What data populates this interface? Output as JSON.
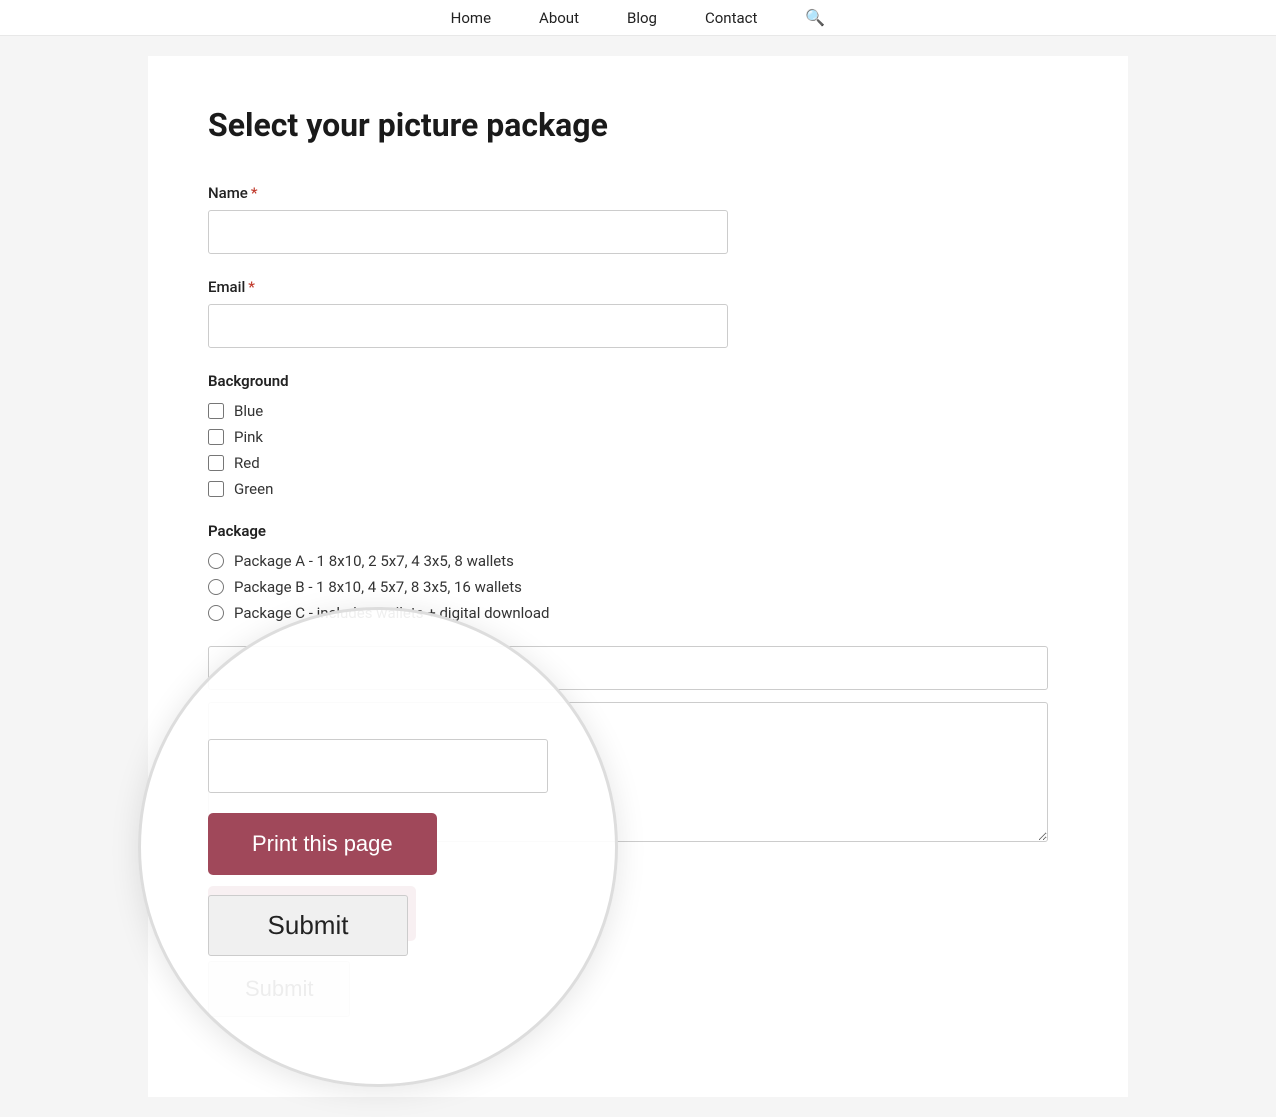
{
  "nav": {
    "items": [
      {
        "label": "Home",
        "id": "home"
      },
      {
        "label": "About",
        "id": "about"
      },
      {
        "label": "Blog",
        "id": "blog"
      },
      {
        "label": "Contact",
        "id": "contact"
      }
    ],
    "search_icon": "🔍"
  },
  "page": {
    "title": "Select your picture package"
  },
  "form": {
    "name_label": "Name",
    "email_label": "Email",
    "background_label": "Background",
    "background_options": [
      {
        "label": "Blue",
        "id": "bg-blue"
      },
      {
        "label": "Pink",
        "id": "bg-pink"
      },
      {
        "label": "Red",
        "id": "bg-red"
      },
      {
        "label": "Green",
        "id": "bg-green"
      }
    ],
    "package_label": "Package",
    "package_options": [
      {
        "label": "Package A - 1 8x10, 2 5x7, 4 3x5, 8 wallets",
        "id": "pkg-a"
      },
      {
        "label": "Package B - 1 8x10, 4 5x7, 8 3x5, 16 wallets",
        "id": "pkg-b"
      },
      {
        "label": "Package C - includes wallets + digital download",
        "id": "pkg-c"
      }
    ],
    "textarea_placeholder": "",
    "print_button_label": "Print this page",
    "submit_button_label": "Submit"
  }
}
